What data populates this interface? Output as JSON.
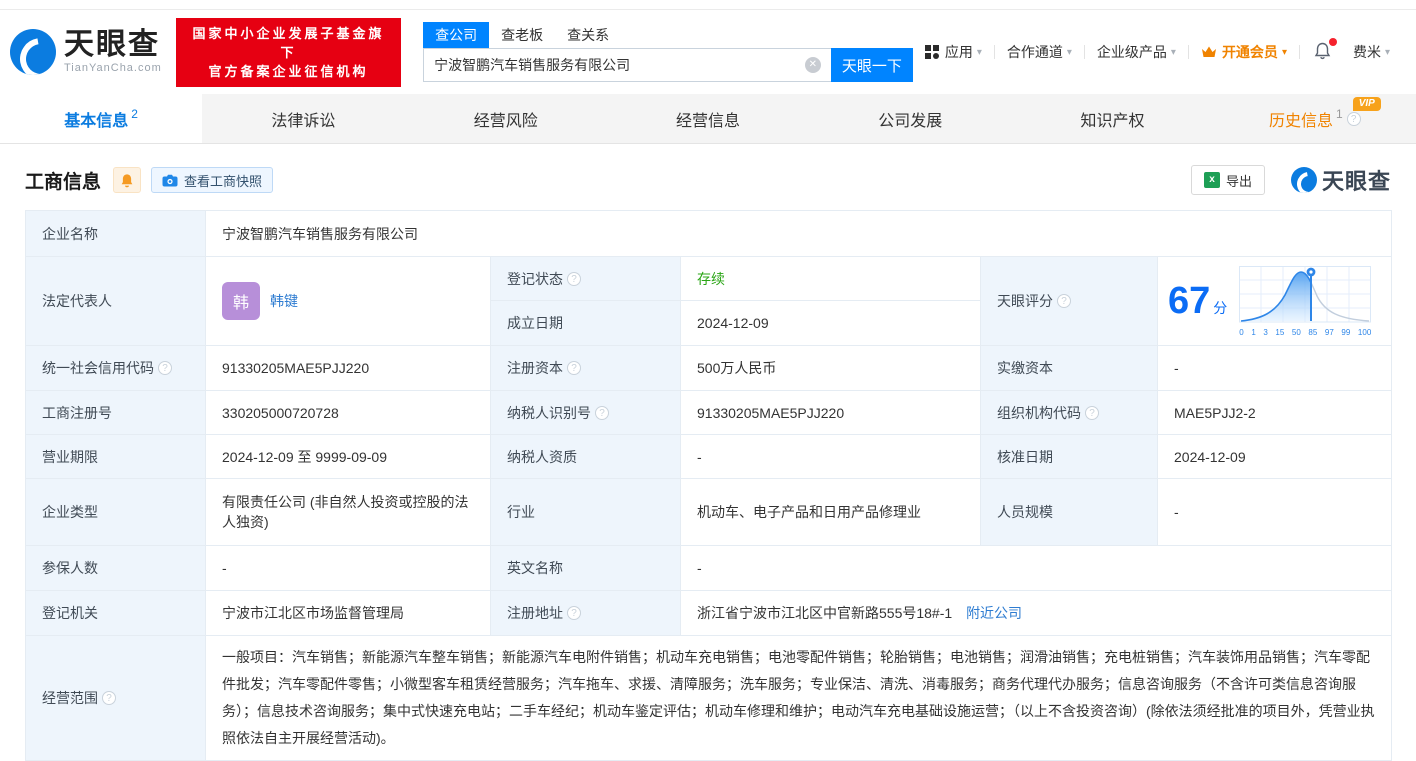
{
  "brand": {
    "name": "天眼查",
    "domain": "TianYanCha.com",
    "badge_line1": "国家中小企业发展子基金旗下",
    "badge_line2": "官方备案企业征信机构"
  },
  "icons": {
    "caret_down": "▾",
    "help_mark": "?",
    "clear_mark": "✕",
    "xls_letter": "x",
    "vip": "VIP"
  },
  "search": {
    "tabs": [
      "查公司",
      "查老板",
      "查关系"
    ],
    "value": "宁波智鹏汽车销售服务有限公司",
    "submit_label": "天眼一下"
  },
  "top_nav": {
    "items": [
      "应用",
      "合作通道",
      "企业级产品",
      "开通会员",
      "费米"
    ]
  },
  "page_tabs": [
    {
      "label": "基本信息",
      "count": "2"
    },
    {
      "label": "法律诉讼",
      "count": ""
    },
    {
      "label": "经营风险",
      "count": ""
    },
    {
      "label": "经营信息",
      "count": ""
    },
    {
      "label": "公司发展",
      "count": ""
    },
    {
      "label": "知识产权",
      "count": ""
    },
    {
      "label": "历史信息",
      "count": "1"
    }
  ],
  "section": {
    "title": "工商信息",
    "snapshot_label": "查看工商快照",
    "export_label": "导出",
    "watermark": "天眼查"
  },
  "score_chart": {
    "type": "area",
    "title": "天眼评分",
    "score": "67",
    "unit": "分",
    "ticks": [
      "0",
      "1",
      "3",
      "15",
      "50",
      "85",
      "97",
      "99",
      "100"
    ],
    "marker_percentile": 67,
    "accent_color": "#2e86e8"
  },
  "fields": {
    "company_name": {
      "label": "企业名称",
      "value": "宁波智鹏汽车销售服务有限公司"
    },
    "legal_rep": {
      "label": "法定代表人",
      "avatar": "韩",
      "name": "韩键"
    },
    "reg_status": {
      "label": "登记状态",
      "value": "存续"
    },
    "establish_date": {
      "label": "成立日期",
      "value": "2024-12-09"
    },
    "credit_code": {
      "label": "统一社会信用代码",
      "value": "91330205MAE5PJJ220"
    },
    "reg_capital": {
      "label": "注册资本",
      "value": "500万人民币"
    },
    "paid_capital": {
      "label": "实缴资本",
      "value": "-"
    },
    "reg_number": {
      "label": "工商注册号",
      "value": "330205000720728"
    },
    "taxpayer_id": {
      "label": "纳税人识别号",
      "value": "91330205MAE5PJJ220"
    },
    "org_code": {
      "label": "组织机构代码",
      "value": "MAE5PJJ2-2"
    },
    "business_term": {
      "label": "营业期限",
      "value": "2024-12-09 至 9999-09-09"
    },
    "taxpayer_qual": {
      "label": "纳税人资质",
      "value": "-"
    },
    "approval_date": {
      "label": "核准日期",
      "value": "2024-12-09"
    },
    "company_type": {
      "label": "企业类型",
      "value": "有限责任公司 (非自然人投资或控股的法人独资)"
    },
    "industry": {
      "label": "行业",
      "value": "机动车、电子产品和日用产品修理业"
    },
    "staff_size": {
      "label": "人员规模",
      "value": "-"
    },
    "insured_count": {
      "label": "参保人数",
      "value": "-"
    },
    "english_name": {
      "label": "英文名称",
      "value": "-"
    },
    "reg_authority": {
      "label": "登记机关",
      "value": "宁波市江北区市场监督管理局"
    },
    "reg_address": {
      "label": "注册地址",
      "value": "浙江省宁波市江北区中官新路555号18#-1",
      "link": "附近公司"
    },
    "business_scope": {
      "label": "经营范围",
      "value": "一般项目：汽车销售；新能源汽车整车销售；新能源汽车电附件销售；机动车充电销售；电池零配件销售；轮胎销售；电池销售；润滑油销售；充电桩销售；汽车装饰用品销售；汽车零配件批发；汽车零配件零售；小微型客车租赁经营服务；汽车拖车、求援、清障服务；洗车服务；专业保洁、清洗、消毒服务；商务代理代办服务；信息咨询服务（不含许可类信息咨询服务）；信息技术咨询服务；集中式快速充电站；二手车经纪；机动车鉴定评估；机动车修理和维护；电动汽车充电基础设施运营；（以上不含投资咨询）(除依法须经批准的项目外，凭营业执照依法自主开展经营活动)。"
    }
  }
}
